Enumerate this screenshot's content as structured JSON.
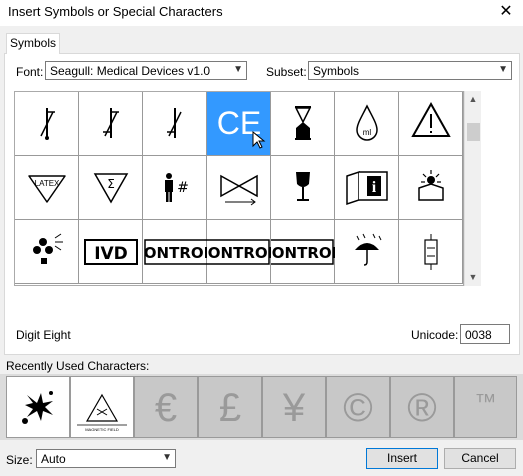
{
  "window": {
    "title": "Insert Symbols or Special Characters",
    "close_glyph": "✕"
  },
  "tabs": [
    {
      "label": "Symbols"
    }
  ],
  "font": {
    "label": "Font:",
    "value": "Seagull: Medical Devices v1.0"
  },
  "subset": {
    "label": "Subset:",
    "value": "Symbols"
  },
  "grid": {
    "selected_index": 3,
    "cells": [
      {
        "icon": "temperature-limit-upper-icon"
      },
      {
        "icon": "temperature-limit-icon"
      },
      {
        "icon": "temperature-limit-lower-icon"
      },
      {
        "icon": "ce-mark-icon",
        "text": "CE"
      },
      {
        "icon": "hourglass-icon"
      },
      {
        "icon": "drop-ml-icon",
        "text": "ml"
      },
      {
        "icon": "warning-icon"
      },
      {
        "icon": "latex-icon",
        "text": "LATEX"
      },
      {
        "icon": "sigma-triangle-icon",
        "text": "Σ"
      },
      {
        "icon": "patient-number-icon",
        "text": "#"
      },
      {
        "icon": "sterile-barrier-icon"
      },
      {
        "icon": "fragile-glass-icon"
      },
      {
        "icon": "info-manual-icon",
        "text": "i"
      },
      {
        "icon": "keep-from-sunlight-icon"
      },
      {
        "icon": "biohazard-icon"
      },
      {
        "icon": "ivd-icon",
        "text": "IVD"
      },
      {
        "icon": "control-icon",
        "text": "CONTROL"
      },
      {
        "icon": "control-icon",
        "text": "CONTROL"
      },
      {
        "icon": "control-icon",
        "text": "CONTROL"
      },
      {
        "icon": "keep-dry-umbrella-icon"
      },
      {
        "icon": "pressure-limit-icon"
      }
    ]
  },
  "description": "Digit Eight",
  "unicode": {
    "label": "Unicode:",
    "value": "0038"
  },
  "recent": {
    "label": "Recently Used Characters:",
    "items": [
      {
        "icon": "explosive-icon"
      },
      {
        "icon": "magnetic-field-icon",
        "text": "MAGNETIC FIELD"
      },
      {
        "icon": "euro-icon",
        "text": "€"
      },
      {
        "icon": "pound-icon",
        "text": "£"
      },
      {
        "icon": "yen-icon",
        "text": "¥"
      },
      {
        "icon": "copyright-icon",
        "text": "©"
      },
      {
        "icon": "registered-icon",
        "text": "®"
      },
      {
        "icon": "trademark-icon",
        "text": "™"
      }
    ]
  },
  "size": {
    "label": "Size:",
    "value": "Auto"
  },
  "buttons": {
    "insert": "Insert",
    "cancel": "Cancel"
  }
}
